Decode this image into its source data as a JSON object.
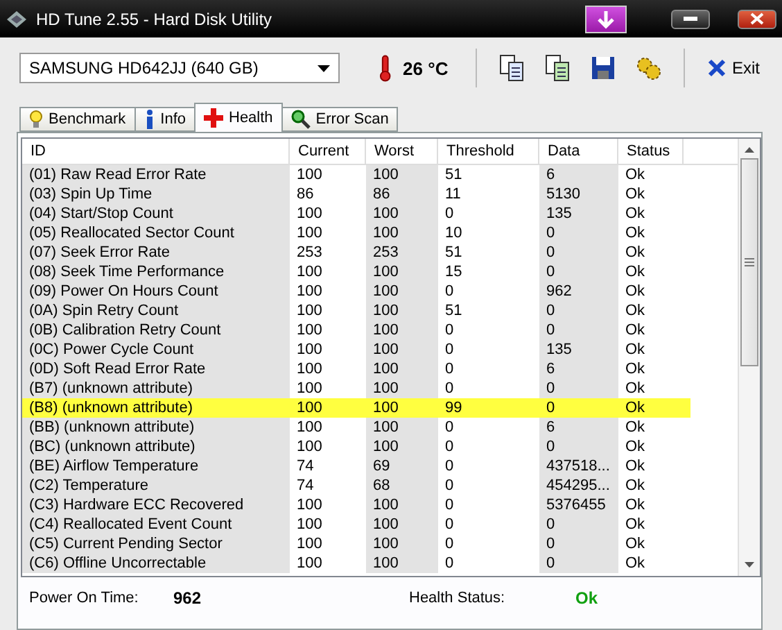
{
  "window": {
    "title": "HD Tune 2.55 - Hard Disk Utility"
  },
  "toolbar": {
    "drive": "SAMSUNG HD642JJ (640 GB)",
    "temperature": "26 °C",
    "exit": "Exit"
  },
  "tabs": [
    {
      "label": "Benchmark",
      "selected": false
    },
    {
      "label": "Info",
      "selected": false
    },
    {
      "label": "Health",
      "selected": true
    },
    {
      "label": "Error Scan",
      "selected": false
    }
  ],
  "table": {
    "columns": [
      "ID",
      "Current",
      "Worst",
      "Threshold",
      "Data",
      "Status"
    ],
    "rows": [
      {
        "cells": [
          "(01) Raw Read Error Rate",
          "100",
          "100",
          "51",
          "6",
          "Ok"
        ],
        "selected": false
      },
      {
        "cells": [
          "(03) Spin Up Time",
          "86",
          "86",
          "11",
          "5130",
          "Ok"
        ],
        "selected": false
      },
      {
        "cells": [
          "(04) Start/Stop Count",
          "100",
          "100",
          "0",
          "135",
          "Ok"
        ],
        "selected": false
      },
      {
        "cells": [
          "(05) Reallocated Sector Count",
          "100",
          "100",
          "10",
          "0",
          "Ok"
        ],
        "selected": false
      },
      {
        "cells": [
          "(07) Seek Error Rate",
          "253",
          "253",
          "51",
          "0",
          "Ok"
        ],
        "selected": false
      },
      {
        "cells": [
          "(08) Seek Time Performance",
          "100",
          "100",
          "15",
          "0",
          "Ok"
        ],
        "selected": false
      },
      {
        "cells": [
          "(09) Power On Hours Count",
          "100",
          "100",
          "0",
          "962",
          "Ok"
        ],
        "selected": false
      },
      {
        "cells": [
          "(0A) Spin Retry Count",
          "100",
          "100",
          "51",
          "0",
          "Ok"
        ],
        "selected": false
      },
      {
        "cells": [
          "(0B) Calibration Retry Count",
          "100",
          "100",
          "0",
          "0",
          "Ok"
        ],
        "selected": false
      },
      {
        "cells": [
          "(0C) Power Cycle Count",
          "100",
          "100",
          "0",
          "135",
          "Ok"
        ],
        "selected": false
      },
      {
        "cells": [
          "(0D) Soft Read Error Rate",
          "100",
          "100",
          "0",
          "6",
          "Ok"
        ],
        "selected": false
      },
      {
        "cells": [
          "(B7) (unknown attribute)",
          "100",
          "100",
          "0",
          "0",
          "Ok"
        ],
        "selected": false
      },
      {
        "cells": [
          "(B8) (unknown attribute)",
          "100",
          "100",
          "99",
          "0",
          "Ok"
        ],
        "selected": true
      },
      {
        "cells": [
          "(BB) (unknown attribute)",
          "100",
          "100",
          "0",
          "6",
          "Ok"
        ],
        "selected": false
      },
      {
        "cells": [
          "(BC) (unknown attribute)",
          "100",
          "100",
          "0",
          "0",
          "Ok"
        ],
        "selected": false
      },
      {
        "cells": [
          "(BE) Airflow Temperature",
          "74",
          "69",
          "0",
          "437518...",
          "Ok"
        ],
        "selected": false
      },
      {
        "cells": [
          "(C2) Temperature",
          "74",
          "68",
          "0",
          "454295...",
          "Ok"
        ],
        "selected": false
      },
      {
        "cells": [
          "(C3) Hardware ECC Recovered",
          "100",
          "100",
          "0",
          "5376455",
          "Ok"
        ],
        "selected": false
      },
      {
        "cells": [
          "(C4) Reallocated Event Count",
          "100",
          "100",
          "0",
          "0",
          "Ok"
        ],
        "selected": false
      },
      {
        "cells": [
          "(C5) Current Pending Sector",
          "100",
          "100",
          "0",
          "0",
          "Ok"
        ],
        "selected": false
      },
      {
        "cells": [
          "(C6) Offline Uncorrectable",
          "100",
          "100",
          "0",
          "0",
          "Ok"
        ],
        "selected": false
      }
    ]
  },
  "footer": {
    "power_on_label": "Power On Time:",
    "power_on_value": "962",
    "health_label": "Health Status:",
    "health_value": "Ok"
  }
}
